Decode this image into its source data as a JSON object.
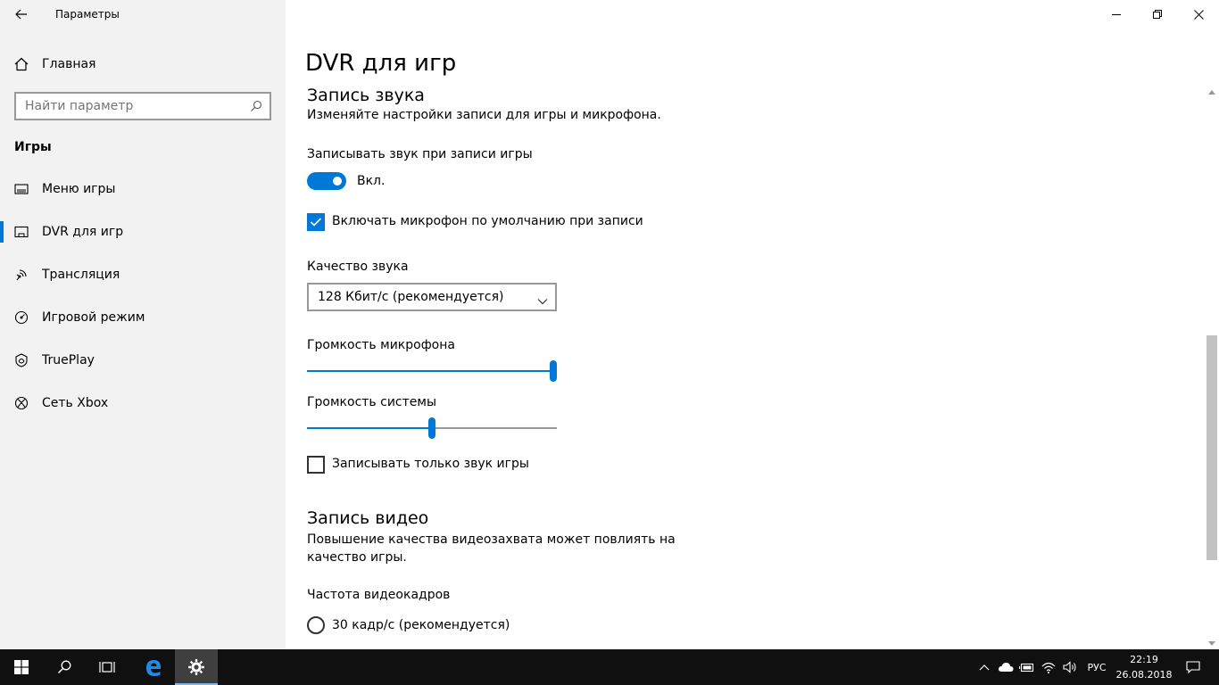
{
  "window": {
    "title": "Параметры"
  },
  "sidebar": {
    "home_label": "Главная",
    "search_placeholder": "Найти параметр",
    "section_title": "Игры",
    "items": [
      {
        "label": "Меню игры",
        "icon": "game-bar-icon"
      },
      {
        "label": "DVR для игр",
        "icon": "game-dvr-icon",
        "active": true
      },
      {
        "label": "Трансляция",
        "icon": "broadcast-icon"
      },
      {
        "label": "Игровой режим",
        "icon": "game-mode-icon"
      },
      {
        "label": "TruePlay",
        "icon": "trueplay-icon"
      },
      {
        "label": "Сеть Xbox",
        "icon": "xbox-icon"
      }
    ]
  },
  "main": {
    "page_title": "DVR для игр",
    "audio": {
      "heading": "Запись звука",
      "description": "Изменяйте настройки записи для игры и микрофона.",
      "record_audio_label": "Записывать звук при записи игры",
      "record_audio_state": "Вкл.",
      "mic_default_label": "Включать микрофон по умолчанию при записи",
      "quality_label": "Качество звука",
      "quality_value": "128 Кбит/с (рекомендуется)",
      "mic_volume_label": "Громкость микрофона",
      "mic_volume": 1.0,
      "system_volume_label": "Громкость системы",
      "system_volume": 0.5,
      "game_audio_only_label": "Записывать только звук игры"
    },
    "video": {
      "heading": "Запись видео",
      "description": "Повышение качества видеозахвата может повлиять на качество игры.",
      "framerate_label": "Частота видеокадров",
      "framerate_option": "30 кадр/с (рекомендуется)"
    }
  },
  "taskbar": {
    "language": "РУС",
    "time": "22:19",
    "date": "26.08.2018",
    "accent": "#0078d7"
  }
}
